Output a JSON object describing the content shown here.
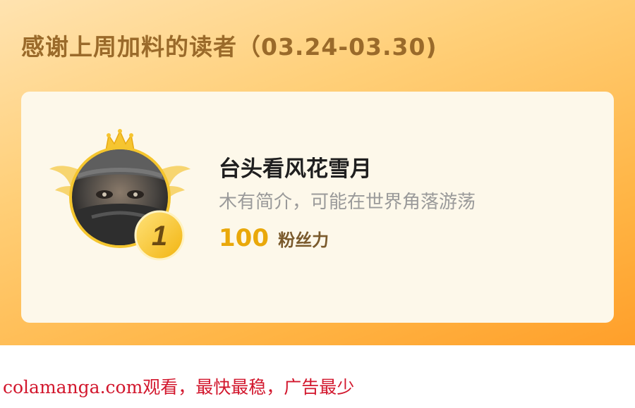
{
  "banner": {
    "title": "感谢上周加料的读者（03.24-03.30)"
  },
  "top_reader": {
    "rank": "1",
    "name": "台头看风花雪月",
    "bio": "木有简介，可能在世界角落游荡",
    "fan_power_value": "100",
    "fan_power_label": "粉丝力"
  },
  "footer": {
    "text": "colamanga.com观看，最快最稳，广告最少"
  },
  "colors": {
    "banner_gradient_start": "#ffe3b0",
    "banner_gradient_end": "#ff9f2a",
    "title_color": "#9a6a2a",
    "card_bg": "#fdf8ea",
    "fan_value_color": "#e9a80a",
    "footer_color": "#d2172d"
  },
  "icons": {
    "crown": "crown-icon",
    "wings": "wings-icon",
    "rank_badge": "rank-badge-icon"
  }
}
